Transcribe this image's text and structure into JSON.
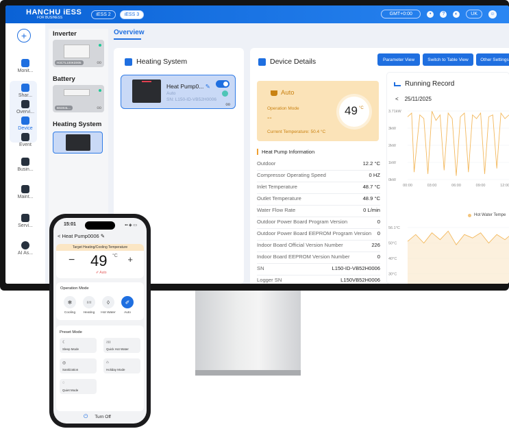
{
  "topbar": {
    "brand": "HANCHU iESS",
    "brand_sub": "FOR BUSINESS",
    "pills": [
      "iESS 2",
      "iESS 3"
    ],
    "timezone": "GMT+0:00",
    "language": "UK"
  },
  "nav": {
    "items": [
      "Monit...",
      "Shar...",
      "Overvi...",
      "Device",
      "Event",
      "Busin...",
      "Maint...",
      "Servi...",
      "AI As..."
    ]
  },
  "device_list": {
    "inverter": "Inverter",
    "inverter_tag": "H3CTL100KD005",
    "battery": "Battery",
    "battery_tag": "BS3S4L...",
    "heating": "Heating System",
    "oo": "oo"
  },
  "overview": {
    "tab": "Overview"
  },
  "heating_panel": {
    "title": "Heating System",
    "card": {
      "name": "Heat Pump0...",
      "mode": "Auto",
      "sn": "SN: L150-ID-VB52H0006",
      "oo": "oo"
    }
  },
  "details": {
    "title": "Device Details",
    "buttons": [
      "Parameter View",
      "Switch to Table View",
      "Other Settings"
    ],
    "auto": {
      "label": "Auto",
      "op_mode_label": "Operation Mode",
      "op_mode_value": "--",
      "current_temp": "Current Temperature: 50.4 °C",
      "setpoint": "49",
      "unit": "°C"
    },
    "info_title": "Heat Pump Information",
    "rows": [
      {
        "k": "Outdoor",
        "v": "12.2 °C"
      },
      {
        "k": "Compressor Operating Speed",
        "v": "0 HZ"
      },
      {
        "k": "Inlet Temperature",
        "v": "48.7 °C"
      },
      {
        "k": "Outlet Temperature",
        "v": "48.9 °C"
      },
      {
        "k": "Water Flow Rate",
        "v": "0 L/min"
      },
      {
        "k": "Outdoor Power Board Program Version",
        "v": "0"
      },
      {
        "k": "Outdoor Power Board EEPROM Program Version",
        "v": "0"
      },
      {
        "k": "Indoor Board Official Version Number",
        "v": "226"
      },
      {
        "k": "Indoor Board EEPROM Version Number",
        "v": "0"
      },
      {
        "k": "SN",
        "v": "L150-ID-VB52H0006"
      },
      {
        "k": "Logger SN",
        "v": "L150VB52H0006"
      }
    ]
  },
  "running_record": {
    "title": "Running Record",
    "date_prev": "<",
    "date": "25/11/2025",
    "legend": "Hot Water Tempe"
  },
  "chart_data": [
    {
      "type": "line",
      "title": "",
      "ylabels": [
        "3.71kW",
        "3kW",
        "2kW",
        "1kW",
        "0kW"
      ],
      "ylim": [
        0,
        3.71
      ],
      "xlabels": [
        "00:00",
        "03:00",
        "06:00",
        "09:00",
        "12:00"
      ],
      "x": [
        0,
        0.5,
        0.8,
        1.5,
        2.0,
        2.5,
        3.0,
        3.5,
        4.0,
        4.5,
        5.0,
        5.5,
        6.0,
        6.5,
        7.0,
        7.5,
        8.0,
        8.5,
        9.0,
        9.5,
        10.0,
        10.5,
        11.0,
        11.5,
        12.0,
        12.5
      ],
      "values": [
        3.4,
        3.6,
        0.4,
        3.5,
        3.3,
        0.3,
        3.7,
        3.2,
        3.5,
        0.5,
        3.6,
        3.3,
        0.2,
        3.4,
        3.6,
        0.4,
        3.5,
        3.3,
        3.6,
        0.3,
        3.4,
        3.5,
        0.6,
        3.6,
        3.3,
        3.5
      ]
    },
    {
      "type": "area",
      "title": "",
      "ylabels": [
        "56.1°C",
        "50°C",
        "40°C",
        "30°C",
        "20°C"
      ],
      "ylim": [
        20,
        56.1
      ],
      "x": [
        0,
        1,
        2,
        3,
        4,
        5,
        6,
        7,
        8,
        9,
        10,
        11,
        12,
        12.5
      ],
      "values": [
        48,
        52,
        47,
        53,
        49,
        54,
        46,
        52,
        50,
        53,
        47,
        52,
        49,
        51
      ]
    }
  ],
  "phone": {
    "time": "15:01",
    "status": "▪▪ ◈ ▭",
    "header": "< Heat Pump0006 ✎",
    "target_label": "Target Heating/Cooling Temperature",
    "minus": "−",
    "plus": "+",
    "temp": "49",
    "deg": "°C",
    "temp_mode": "✐ Auto",
    "op_mode_title": "Operation Mode",
    "modes": [
      {
        "icon": "❄",
        "label": "Cooling"
      },
      {
        "icon": "≀≀≀",
        "label": "Heating"
      },
      {
        "icon": "◊",
        "label": "Hot Water"
      },
      {
        "icon": "✐",
        "label": "Auto"
      }
    ],
    "preset_title": "Preset Mode",
    "presets": [
      {
        "icon": "☾",
        "label": "Sleep Mode"
      },
      {
        "icon": "≀≀≀",
        "label": "Quick Hot Water"
      },
      {
        "icon": "◎",
        "label": "Sanitization"
      },
      {
        "icon": "⌂",
        "label": "Holiday Mode"
      },
      {
        "icon": "◌",
        "label": "Quiet Mode"
      }
    ],
    "turn_off": "Turn Off",
    "power_icon": "⏻"
  },
  "colors": {
    "accent": "#1f6fe0",
    "auto_card": "#fbe3b8",
    "chart_line": "#f3b85c"
  }
}
